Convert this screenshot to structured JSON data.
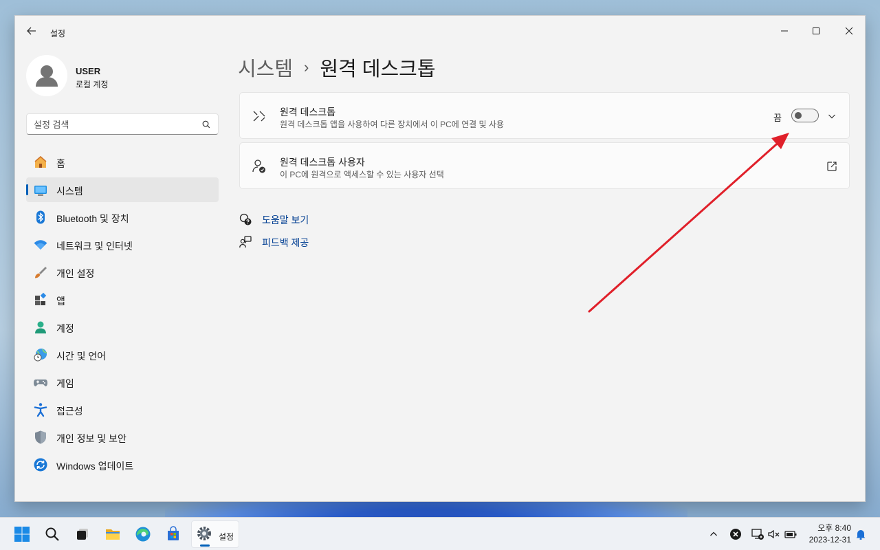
{
  "window": {
    "app_title": "설정"
  },
  "profile": {
    "name": "USER",
    "account_type": "로컬 계정"
  },
  "search": {
    "placeholder": "설정 검색"
  },
  "sidebar": {
    "items": [
      {
        "label": "홈",
        "icon": "home-icon"
      },
      {
        "label": "시스템",
        "icon": "system-icon",
        "active": true
      },
      {
        "label": "Bluetooth 및 장치",
        "icon": "bluetooth-icon"
      },
      {
        "label": "네트워크 및 인터넷",
        "icon": "wifi-icon"
      },
      {
        "label": "개인 설정",
        "icon": "brush-icon"
      },
      {
        "label": "앱",
        "icon": "apps-icon"
      },
      {
        "label": "계정",
        "icon": "account-icon"
      },
      {
        "label": "시간 및 언어",
        "icon": "globe-clock-icon"
      },
      {
        "label": "게임",
        "icon": "gamepad-icon"
      },
      {
        "label": "접근성",
        "icon": "accessibility-icon"
      },
      {
        "label": "개인 정보 및 보안",
        "icon": "shield-icon"
      },
      {
        "label": "Windows 업데이트",
        "icon": "update-icon"
      }
    ]
  },
  "breadcrumb": {
    "parent": "시스템",
    "separator": "›",
    "current": "원격 데스크톱"
  },
  "cards": {
    "remote_desktop": {
      "title": "원격 데스크톱",
      "description": "원격 데스크톱 앱을 사용하여 다른 장치에서 이 PC에 연결 및 사용",
      "toggle_state": "끔",
      "toggle_on": false
    },
    "remote_users": {
      "title": "원격 데스크톱 사용자",
      "description": "이 PC에 원격으로 액세스할 수 있는 사용자 선택"
    }
  },
  "help_links": {
    "help": "도움말 보기",
    "feedback": "피드백 제공"
  },
  "taskbar": {
    "active_app": "설정",
    "clock_time": "오후 8:40",
    "clock_date": "2023-12-31"
  },
  "colors": {
    "accent": "#005fb8",
    "annotation_arrow": "#e0202a",
    "link": "#003e92"
  }
}
